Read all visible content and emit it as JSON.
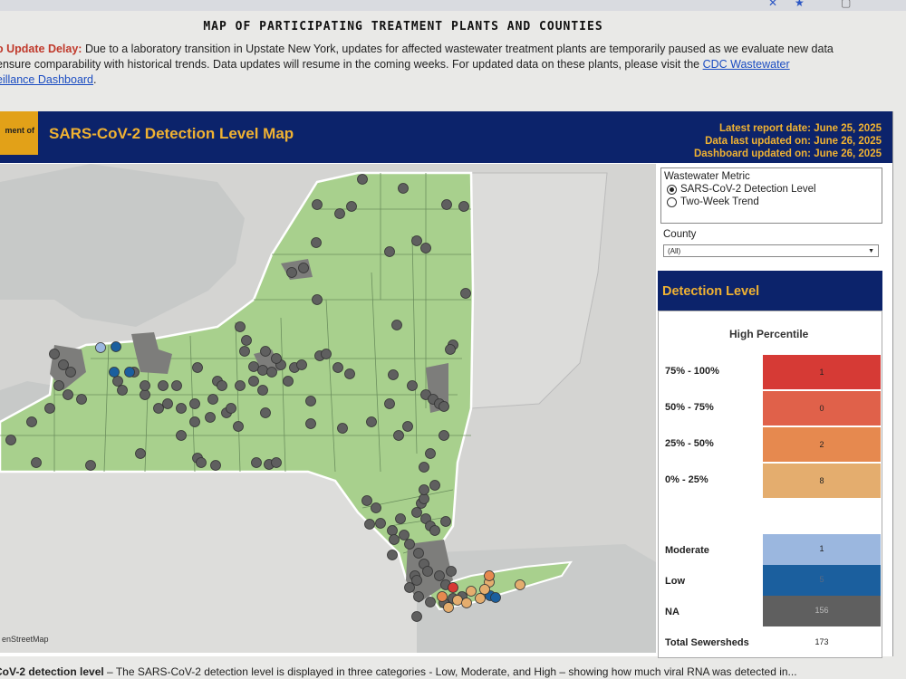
{
  "page": {
    "title": "MAP OF PARTICIPATING TREATMENT PLANTS AND COUNTIES",
    "notice_label": "o Update Delay:",
    "notice_text": " Due to a laboratory transition in Upstate New York, updates for affected wastewater treatment plants are temporarily paused as we evaluate new data ensure comparability with historical trends. Data updates will resume in the coming weeks. For updated data on these plants, please visit the ",
    "notice_link": "CDC Wastewater",
    "notice_link2": "eillance Dashboard",
    "notice_end": "."
  },
  "dashboard": {
    "tab_stub": "ment of",
    "title": "SARS-CoV-2 Detection Level Map",
    "latest_report": "Latest report date: June 25, 2025",
    "data_updated": "Data last updated on: June 26, 2025",
    "dashboard_updated": "Dashboard updated on: June 26, 2025",
    "map_attribution": "enStreetMap"
  },
  "controls": {
    "metric_heading": "Wastewater Metric",
    "metric_options": [
      "SARS-CoV-2 Detection Level",
      "Two-Week Trend"
    ],
    "metric_selected": "SARS-CoV-2 Detection Level",
    "county_heading": "County",
    "county_value": "(All)"
  },
  "legend": {
    "heading": "Detection Level",
    "subheading": "High Percentile",
    "rows": [
      {
        "label": "75% - 100%",
        "count": "1",
        "color": "#d63a35"
      },
      {
        "label": "50% - 75%",
        "count": "0",
        "color": "#e0614a"
      },
      {
        "label": "25% - 50%",
        "count": "2",
        "color": "#e6894f"
      },
      {
        "label": "0% - 25%",
        "count": "8",
        "color": "#e4ad6e"
      },
      {
        "label": "Moderate",
        "count": "1",
        "color": "#9bb7df"
      },
      {
        "label": "Low",
        "count": "5",
        "color": "#1b5f9e"
      },
      {
        "label": "NA",
        "count": "156",
        "color": "#5f5f5f"
      }
    ],
    "total_label": "Total Sewersheds",
    "total_count": "173"
  },
  "footer": {
    "bold": "CoV-2 detection level",
    "text": " – The SARS-CoV-2 detection level is displayed in three categories - Low, Moderate, and High – showing how much viral RNA was detected in..."
  },
  "colors": {
    "header_bg": "#0c236b",
    "accent": "#f0b232",
    "state_fill": "#a8d08d",
    "na_dot": "#5f5f5f"
  }
}
